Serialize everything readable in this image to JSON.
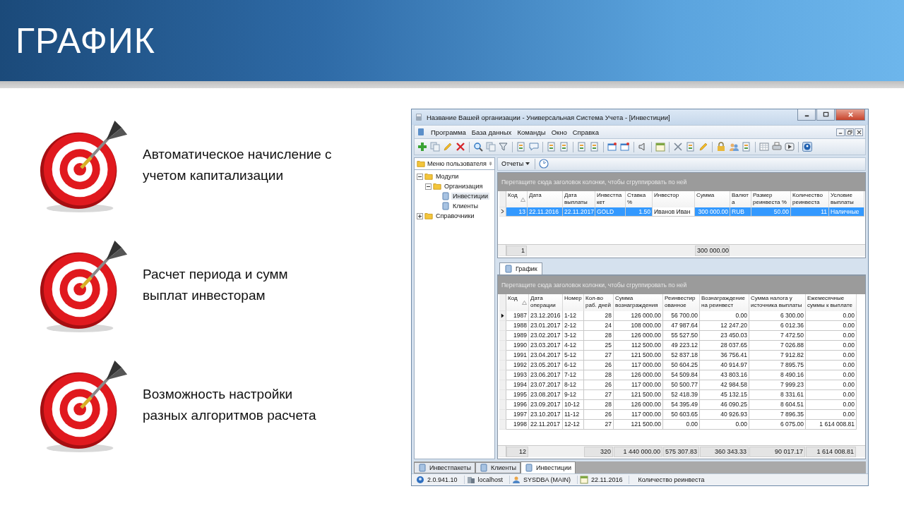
{
  "slide_title": "ГРАФИК",
  "features": [
    {
      "lines": [
        "Автоматическое начисление с",
        "учетом капитализации"
      ]
    },
    {
      "lines": [
        "Расчет периода и сумм",
        "выплат инвесторам"
      ]
    },
    {
      "lines": [
        "Возможность настройки",
        "разных алгоритмов расчета"
      ]
    }
  ],
  "window": {
    "title": "Название Вашей организации - Универсальная Система Учета - [Инвестиции]",
    "menu": [
      "Программа",
      "База данных",
      "Команды",
      "Окно",
      "Справка"
    ],
    "sidebar": {
      "header": "Меню пользователя",
      "tree": [
        {
          "label": "Модули",
          "expanded": true,
          "selected": false,
          "children": [
            {
              "label": "Организация",
              "expanded": true,
              "selected": false,
              "children": [
                {
                  "label": "Инвестиции",
                  "selected": true
                },
                {
                  "label": "Клиенты",
                  "selected": false
                }
              ]
            }
          ]
        },
        {
          "label": "Справочники",
          "expanded": false,
          "selected": false
        }
      ]
    },
    "reports_button": "Отчеты",
    "master_grid": {
      "group_hint": "Перетащите сюда заголовок колонки, чтобы сгруппировать по ней",
      "columns": [
        {
          "label": "Код",
          "sorted": true,
          "kind": "number"
        },
        {
          "label": "Дата",
          "sorted": false,
          "kind": "text"
        },
        {
          "label": "Дата выплаты",
          "sorted": false,
          "kind": "text"
        },
        {
          "label": "Инвестпакет",
          "sorted": false,
          "kind": "text"
        },
        {
          "label": "Ставка %",
          "sorted": false,
          "kind": "number"
        },
        {
          "label": "Инвестор",
          "sorted": false,
          "kind": "text"
        },
        {
          "label": "Сумма",
          "sorted": false,
          "kind": "number"
        },
        {
          "label": "Валюта",
          "sorted": false,
          "kind": "text"
        },
        {
          "label": "Размер реинвеста %",
          "sorted": false,
          "kind": "number"
        },
        {
          "label": "Количество реинвеста",
          "sorted": false,
          "kind": "number"
        },
        {
          "label": "Условие выплаты",
          "sorted": false,
          "kind": "text"
        }
      ],
      "rows": [
        {
          "selected": true,
          "current": true,
          "cells": [
            {
              "text": "13",
              "focused": false
            },
            {
              "text": "22.11.2016",
              "focused": false
            },
            {
              "text": "22.11.2017",
              "focused": false
            },
            {
              "text": "GOLD",
              "focused": false
            },
            {
              "text": "1.50",
              "focused": false
            },
            {
              "text": "Иванов Иван",
              "focused": true
            },
            {
              "text": "300 000.00",
              "focused": false
            },
            {
              "text": "RUB",
              "focused": false
            },
            {
              "text": "50.00",
              "focused": false
            },
            {
              "text": "11",
              "focused": false
            },
            {
              "text": "Наличные",
              "focused": false
            }
          ]
        }
      ],
      "footer": [
        {
          "kind": "total",
          "text": "1"
        },
        {
          "kind": "blank"
        },
        {
          "kind": "blank"
        },
        {
          "kind": "blank"
        },
        {
          "kind": "blank"
        },
        {
          "kind": "blank"
        },
        {
          "kind": "total",
          "text": "300 000.00"
        },
        {
          "kind": "blank"
        },
        {
          "kind": "blank"
        },
        {
          "kind": "blank"
        },
        {
          "kind": "blank"
        }
      ]
    },
    "detail_tabs": [
      {
        "label": "График",
        "selected": true
      }
    ],
    "detail_grid": {
      "group_hint": "Перетащите сюда заголовок колонки, чтобы сгруппировать по ней",
      "columns": [
        {
          "label": "Код",
          "sorted": true,
          "kind": "number"
        },
        {
          "label": "Дата операции",
          "sorted": false,
          "kind": "text"
        },
        {
          "label": "Номер",
          "sorted": false,
          "kind": "text"
        },
        {
          "label": "Кол-во раб. дней",
          "sorted": false,
          "kind": "number"
        },
        {
          "label": "Сумма вознаграждения",
          "sorted": false,
          "kind": "number"
        },
        {
          "label": "Реинвестированное",
          "sorted": false,
          "kind": "number"
        },
        {
          "label": "Вознаграждение на реинвест",
          "sorted": false,
          "kind": "number"
        },
        {
          "label": "Сумма налога у источника выплаты",
          "sorted": false,
          "kind": "number"
        },
        {
          "label": "Ежемесячные суммы к выплате",
          "sorted": false,
          "kind": "number"
        }
      ],
      "rows": [
        {
          "current": true,
          "cells": [
            "1987",
            "23.12.2016",
            "1-12",
            "28",
            "126 000.00",
            "56 700.00",
            "0.00",
            "6 300.00",
            "0.00"
          ]
        },
        {
          "current": false,
          "cells": [
            "1988",
            "23.01.2017",
            "2-12",
            "24",
            "108 000.00",
            "47 987.64",
            "12 247.20",
            "6 012.36",
            "0.00"
          ]
        },
        {
          "current": false,
          "cells": [
            "1989",
            "23.02.2017",
            "3-12",
            "28",
            "126 000.00",
            "55 527.50",
            "23 450.03",
            "7 472.50",
            "0.00"
          ]
        },
        {
          "current": false,
          "cells": [
            "1990",
            "23.03.2017",
            "4-12",
            "25",
            "112 500.00",
            "49 223.12",
            "28 037.65",
            "7 026.88",
            "0.00"
          ]
        },
        {
          "current": false,
          "cells": [
            "1991",
            "23.04.2017",
            "5-12",
            "27",
            "121 500.00",
            "52 837.18",
            "36 756.41",
            "7 912.82",
            "0.00"
          ]
        },
        {
          "current": false,
          "cells": [
            "1992",
            "23.05.2017",
            "6-12",
            "26",
            "117 000.00",
            "50 604.25",
            "40 914.97",
            "7 895.75",
            "0.00"
          ]
        },
        {
          "current": false,
          "cells": [
            "1993",
            "23.06.2017",
            "7-12",
            "28",
            "126 000.00",
            "54 509.84",
            "43 803.16",
            "8 490.16",
            "0.00"
          ]
        },
        {
          "current": false,
          "cells": [
            "1994",
            "23.07.2017",
            "8-12",
            "26",
            "117 000.00",
            "50 500.77",
            "42 984.58",
            "7 999.23",
            "0.00"
          ]
        },
        {
          "current": false,
          "cells": [
            "1995",
            "23.08.2017",
            "9-12",
            "27",
            "121 500.00",
            "52 418.39",
            "45 132.15",
            "8 331.61",
            "0.00"
          ]
        },
        {
          "current": false,
          "cells": [
            "1996",
            "23.09.2017",
            "10-12",
            "28",
            "126 000.00",
            "54 395.49",
            "46 090.25",
            "8 604.51",
            "0.00"
          ]
        },
        {
          "current": false,
          "cells": [
            "1997",
            "23.10.2017",
            "11-12",
            "26",
            "117 000.00",
            "50 603.65",
            "40 926.93",
            "7 896.35",
            "0.00"
          ]
        },
        {
          "current": false,
          "cells": [
            "1998",
            "22.11.2017",
            "12-12",
            "27",
            "121 500.00",
            "0.00",
            "0.00",
            "6 075.00",
            "1 614 008.81"
          ]
        }
      ],
      "footer": [
        {
          "kind": "total",
          "text": "12"
        },
        {
          "kind": "blank"
        },
        {
          "kind": "blank"
        },
        {
          "kind": "total",
          "text": "320"
        },
        {
          "kind": "total",
          "text": "1 440 000.00"
        },
        {
          "kind": "total",
          "text": "575 307.83"
        },
        {
          "kind": "total",
          "text": "360 343.33"
        },
        {
          "kind": "total",
          "text": "90 017.17"
        },
        {
          "kind": "total",
          "text": "1 614 008.81"
        }
      ]
    },
    "bottom_tabs": [
      {
        "label": "Инвестпакеты",
        "selected": false
      },
      {
        "label": "Клиенты",
        "selected": false
      },
      {
        "label": "Инвестиции",
        "selected": true
      }
    ],
    "status_bar": [
      "2.0.941.10",
      "localhost",
      "SYSDBA (MAIN)",
      "22.11.2016",
      "Количество реинвеста"
    ]
  }
}
